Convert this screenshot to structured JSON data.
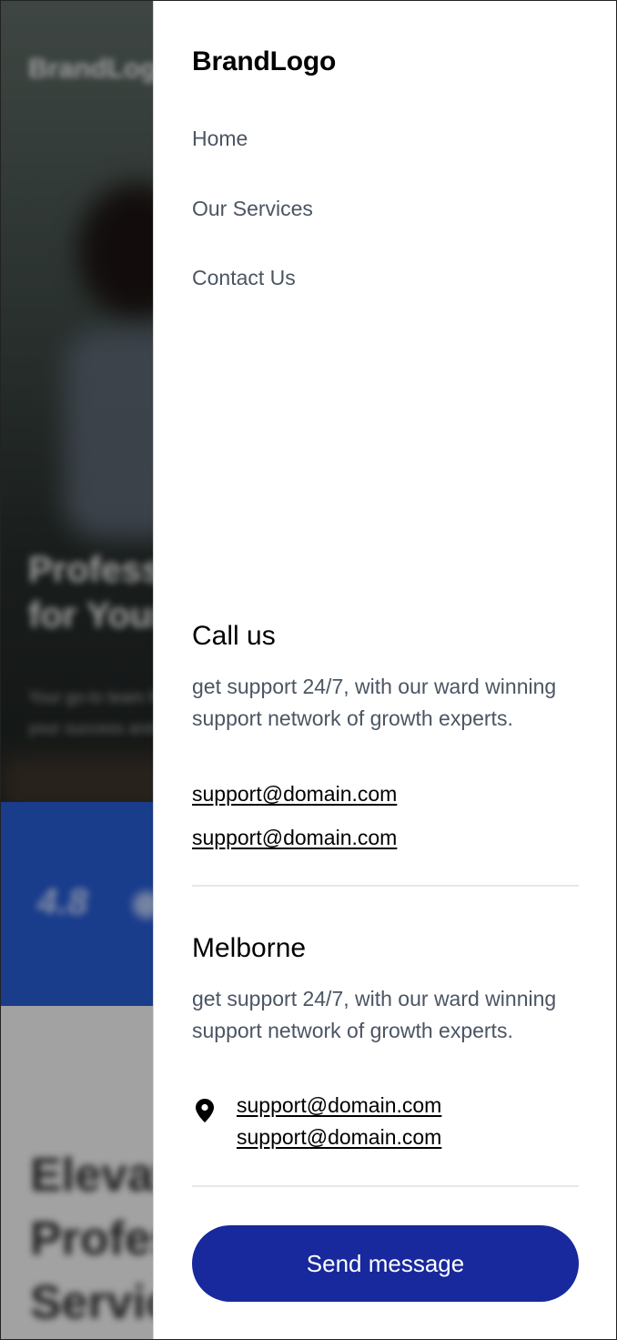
{
  "background": {
    "brand": "BrandLogo",
    "hero_title_lines": [
      "Professional Services",
      "for Your Business"
    ],
    "hero_subtitle_lines": [
      "Your go-to team for",
      "your success and growth"
    ],
    "stat_value": "4.8",
    "section_heading_lines": [
      "Elevate",
      "Professional",
      "Services"
    ]
  },
  "drawer": {
    "brand": "BrandLogo",
    "nav": {
      "home": "Home",
      "services": "Our Services",
      "contact": "Contact Us"
    },
    "call": {
      "title": "Call us",
      "text": "get support 24/7, with our ward winning support network of growth experts.",
      "emails": [
        "support@domain.com",
        "support@domain.com"
      ]
    },
    "melborne": {
      "title": "Melborne",
      "text": "get support 24/7, with our ward winning support network of growth experts.",
      "location_icon": "map-pin-icon",
      "emails": [
        "support@domain.com",
        "support@domain.com"
      ]
    },
    "send_button": "Send message"
  },
  "colors": {
    "button_bg": "#17299c",
    "nav_text": "#4b5563",
    "background_blue_band": "#2456c8"
  }
}
